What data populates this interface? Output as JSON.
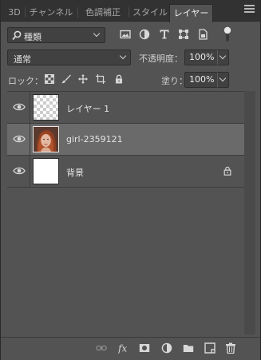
{
  "tabs": [
    {
      "label": "3D",
      "active": false
    },
    {
      "label": "チャンネル",
      "active": false
    },
    {
      "label": "色調補正",
      "active": false
    },
    {
      "label": "スタイル",
      "active": false
    },
    {
      "label": "レイヤー",
      "active": true
    }
  ],
  "filter": {
    "kind_label": "種類",
    "icons": [
      "pixel-filter-icon",
      "adjustment-filter-icon",
      "type-filter-icon",
      "shape-filter-icon",
      "smart-object-filter-icon"
    ]
  },
  "blend": {
    "mode": "通常",
    "opacity_label": "不透明度：",
    "opacity_value": "100%",
    "fill_label": "塗り：",
    "fill_value": "100%"
  },
  "lock": {
    "label": "ロック：",
    "icons": [
      "lock-transparent-pixels-icon",
      "lock-image-pixels-icon",
      "lock-position-icon",
      "lock-artboard-icon",
      "lock-all-icon"
    ]
  },
  "layers": [
    {
      "name": "レイヤー 1",
      "thumbnail": "transparent",
      "visible": true,
      "selected": false,
      "locked": false
    },
    {
      "name": "girl-2359121",
      "thumbnail": "portrait-photo",
      "visible": true,
      "selected": true,
      "locked": false
    },
    {
      "name": "背景",
      "thumbnail": "white",
      "visible": true,
      "selected": false,
      "locked": true
    }
  ],
  "bottom_icons": [
    "link-layers-icon",
    "fx-icon",
    "add-mask-icon",
    "new-adjustment-layer-icon",
    "new-group-icon",
    "new-layer-icon",
    "delete-layer-icon"
  ],
  "colors": {
    "panel_bg": "#535353",
    "selected_row": "#6a6a6a",
    "tabbar_bg": "#323232"
  }
}
